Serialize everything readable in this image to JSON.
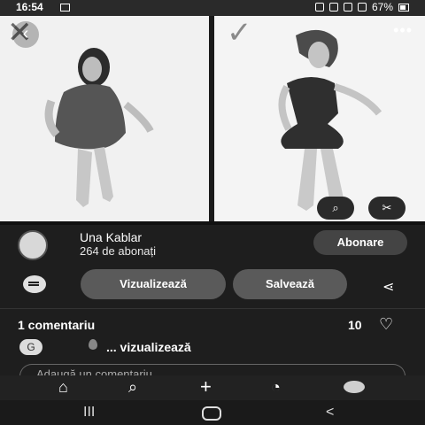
{
  "status_bar": {
    "time": "16:54",
    "battery": "67%"
  },
  "post": {
    "left_mark": "✕",
    "right_mark": "✓",
    "back_icon": "chevron-left-icon",
    "more_icon": "more-icon",
    "lens_icon": "lens-icon",
    "scissors_icon": "scissors-icon"
  },
  "author": {
    "name": "Una Kablar",
    "followers": "264 de abonați",
    "follow_button": "Abonare"
  },
  "actions": {
    "view_button": "Vizualizează",
    "save_button": "Salvează"
  },
  "comments": {
    "count_label": "1 comentariu",
    "likes": "10",
    "first_comment": {
      "avatar_letter": "G",
      "text": "... vizualizează"
    },
    "add_placeholder": "Adaugă un comentariu"
  },
  "bottom_nav": {
    "items": [
      "home-icon",
      "search-icon",
      "plus-icon",
      "chat-icon",
      "profile-icon"
    ]
  },
  "system_nav": {
    "recent_label": "III",
    "back_label": "<"
  }
}
